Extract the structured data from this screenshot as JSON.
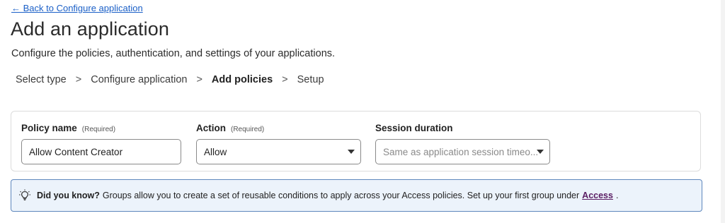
{
  "nav": {
    "back_link": "← Back to Configure application"
  },
  "header": {
    "title": "Add an application",
    "subtitle": "Configure the policies, authentication, and settings of your applications."
  },
  "steps": [
    {
      "label": "Select type",
      "current": false
    },
    {
      "label": "Configure application",
      "current": false
    },
    {
      "label": "Add policies",
      "current": true
    },
    {
      "label": "Setup",
      "current": false
    }
  ],
  "step_separator": ">",
  "policy_form": {
    "policy_name": {
      "label": "Policy name",
      "required_label": "(Required)",
      "value": "Allow Content Creator"
    },
    "action": {
      "label": "Action",
      "required_label": "(Required)",
      "value": "Allow"
    },
    "session_duration": {
      "label": "Session duration",
      "placeholder": "Same as application session timeo..."
    }
  },
  "tip": {
    "icon": "lightbulb-icon",
    "title": "Did you know?",
    "text": "Groups allow you to create a set of reusable conditions to apply across your Access policies. Set up your first group under",
    "link": "Access",
    "suffix": "."
  },
  "colors": {
    "link": "#1a5fc7",
    "banner_bg": "#ecf3fb",
    "banner_border": "#5e87bd",
    "access_link": "#5a1d63"
  }
}
